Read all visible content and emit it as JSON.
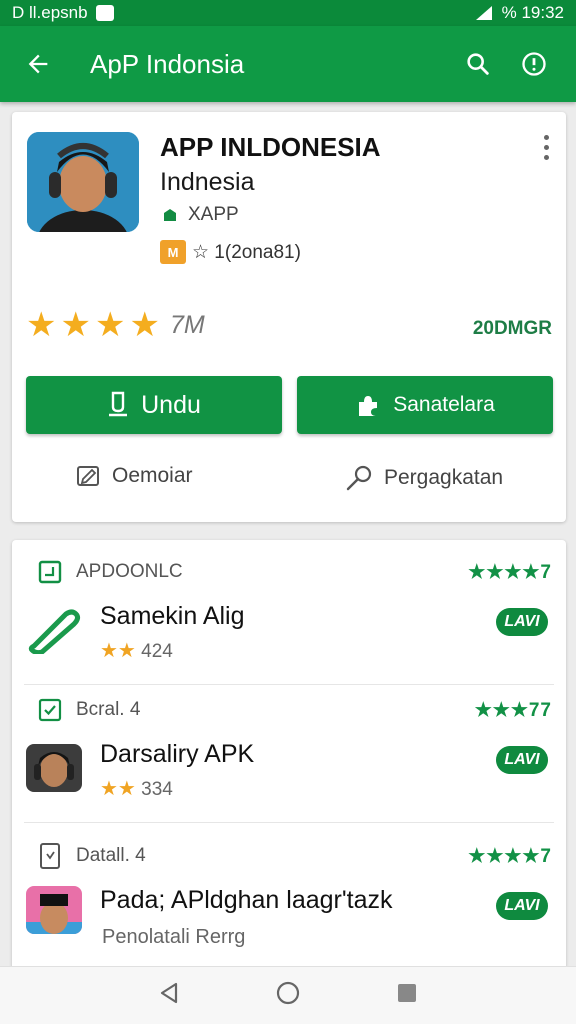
{
  "status": {
    "left": "D ll.epsnb",
    "right": "%  19:32"
  },
  "appbar": {
    "title": "ApP Indonsia"
  },
  "app": {
    "title": "APP INLDONESIA",
    "subtitle": "Indnesia",
    "developer": "XAPP",
    "badge": "M",
    "badge_text": "☆ 1(2ona81)",
    "rating_count": "7M",
    "downloads": "20DMGR"
  },
  "actions": {
    "install_label": "Undu",
    "share_label": "Sanatelara",
    "link_a": "Oemoiar",
    "link_b": "Pergagkatan"
  },
  "sections": [
    {
      "header": "APDOONLC",
      "stars": "★★★★7",
      "item_name": "Samekin Alig",
      "item_rating": "424",
      "pill": "LAVI"
    },
    {
      "header": "Bcral. 4",
      "stars": "★★★77",
      "item_name": "Darsaliry APK",
      "item_rating": "334",
      "pill": "LAVI"
    },
    {
      "header": "Datall. 4",
      "stars": "★★★★7",
      "item_name": "Pada; APldghan laagr'tazk",
      "item_sub": "Penolatali Rerrg",
      "pill": "LAVI"
    }
  ],
  "colors": {
    "primary": "#0f9a45",
    "star": "#f4ad1f"
  }
}
